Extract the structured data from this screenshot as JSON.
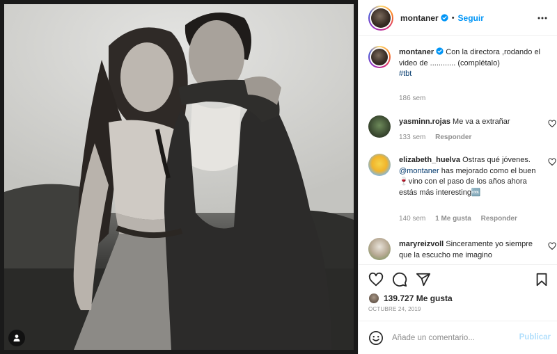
{
  "post": {
    "author": "montaner",
    "follow_label": "Seguir",
    "dot": "•"
  },
  "caption": {
    "user": "montaner",
    "text": "Con la directora ,rodando el video de ............ (complétalo)",
    "hashtag": "#tbt",
    "time": "186 sem"
  },
  "comments": [
    {
      "user": "yasminn.rojas",
      "text": "Me va a extrañar",
      "time": "133 sem",
      "reply": "Responder"
    },
    {
      "user": "elizabeth_huelva",
      "text_a": "Ostras qué jóvenes.",
      "mention": "@montaner",
      "text_b": "has mejorado como el buen 🍷vino con el paso de los años ahora estás más interesting🆒",
      "time": "140 sem",
      "likes": "1 Me gusta",
      "reply": "Responder"
    },
    {
      "user": "maryreizvoll",
      "text": "Sinceramente yo siempre que la escucho me imagino"
    }
  ],
  "likes": {
    "count": "139.727 Me gusta"
  },
  "date": "OCTUBRE 24, 2019",
  "add_comment": {
    "placeholder": "Añade un comentario...",
    "publish": "Publicar"
  },
  "icons": {
    "more": "more-horizontal-icon",
    "like": "heart-icon",
    "comment": "comment-icon",
    "share": "send-icon",
    "save": "bookmark-icon",
    "emoji": "smiley-icon",
    "tag": "user-tag-icon",
    "verified": "verified-badge-icon"
  },
  "colors": {
    "link": "#0095f6",
    "publish_disabled": "#b2dffc",
    "secondary_text": "#8e8e8e",
    "verified": "#0095f6"
  }
}
